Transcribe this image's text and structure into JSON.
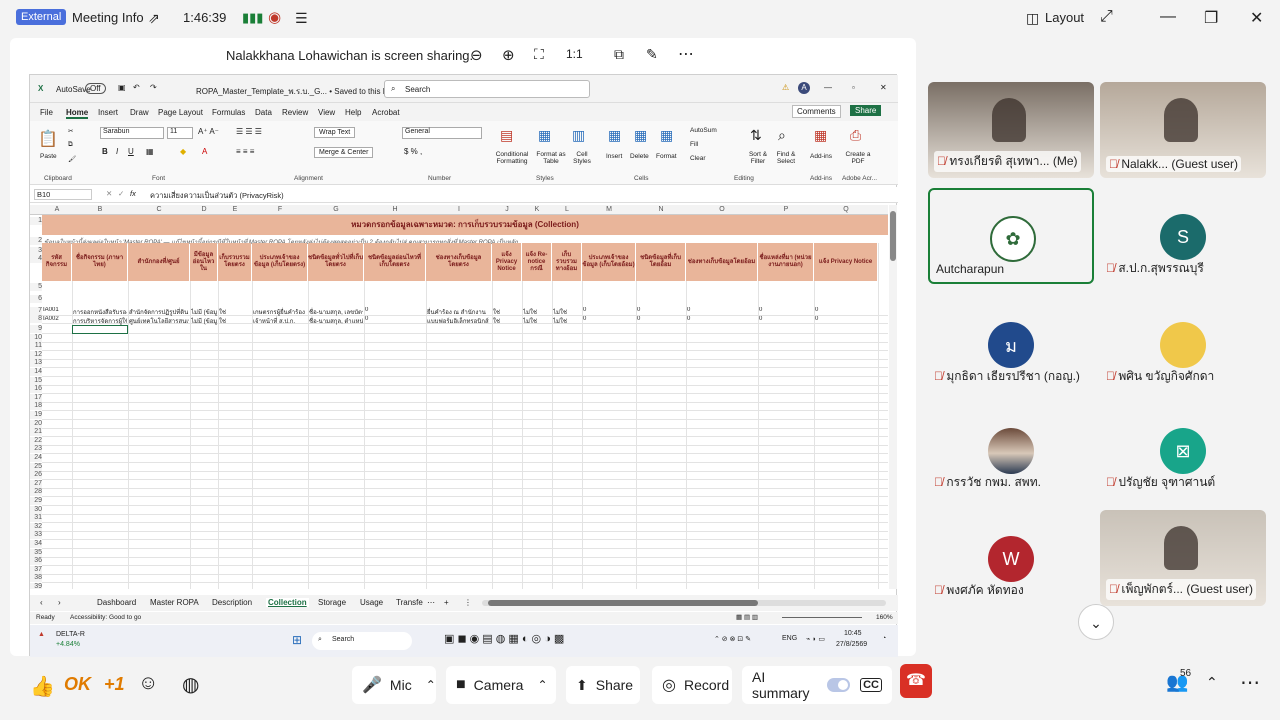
{
  "topbar": {
    "badge": "External",
    "meeting_info": "Meeting Info",
    "timer": "1:46:39",
    "layout": "Layout"
  },
  "share_banner": "Nalakkhana Lohawichan is screen sharing.",
  "excel": {
    "autosave": "AutoSave",
    "autosave_state": "Off",
    "filename": "ROPA_Master_Template_พ.ร.บ._G... • Saved to this PC",
    "search": "Search",
    "menu": [
      "File",
      "Home",
      "Insert",
      "Draw",
      "Page Layout",
      "Formulas",
      "Data",
      "Review",
      "View",
      "Help",
      "Acrobat"
    ],
    "comments": "Comments",
    "share": "Share",
    "font": "Sarabun",
    "font_size": "11",
    "number_format": "General",
    "wrap_text": "Wrap Text",
    "merge_center": "Merge & Center",
    "groups": [
      "Clipboard",
      "Font",
      "Alignment",
      "Number",
      "Styles",
      "Cells",
      "Editing",
      "Add-ins",
      "Adobe Acr..."
    ],
    "ribbon_buttons": [
      "Paste",
      "Conditional Formatting",
      "Format as Table",
      "Cell Styles",
      "Insert",
      "Delete",
      "Format",
      "AutoSum",
      "Fill",
      "Clear",
      "Sort & Filter",
      "Find & Select",
      "Add-ins",
      "Create a PDF"
    ],
    "name_box": "B10",
    "formula": "ความเสี่ยงความเป็นส่วนตัว (PrivacyRisk)",
    "columns": [
      "A",
      "B",
      "C",
      "D",
      "E",
      "F",
      "G",
      "H",
      "I",
      "J",
      "K",
      "L",
      "M",
      "N",
      "O",
      "P",
      "Q"
    ],
    "section_title": "หมวดกรอกข้อมูลเฉพาะหมวด: การเก็บรวบรวมข้อมูล (Collection)",
    "note": "ข้อมูลในหน้านี้ส่งผลต่อใบหน้า 'Master ROPA' — แก้ไขหน้านี้อยู่กรณีที่ในหน้าที่ Master ROPA โดยหลังส่งไม่ต้องสุดสุดอย่าเป็น 2 ต้องกลับไปสู่ คุณสามารถทุกสิ่งที่ Master ROPA เป็นหลัก ",
    "headers": [
      "รหัสกิจกรรม",
      "ชื่อกิจกรรม (ภาษาไทย)",
      "สำนักกองที่/ศูนย์",
      "มีข้อมูลอ่อนไหวใน",
      "เก็บรวบรวมโดยตรง",
      "ประเภทเจ้าของข้อมูล (เก็บโดยตรง)",
      "ชนิดข้อมูลทั่วไปที่เก็บโดยตรง",
      "ชนิดข้อมูลอ่อนไหวที่เก็บโดยตรง",
      "ช่องทางเก็บข้อมูลโดยตรง",
      "แจ้ง Privacy Notice",
      "แจ้ง Re-notice กรณี",
      "เก็บรวบรวมทางอ้อม",
      "ประเภทเจ้าของข้อมูล (เก็บโดยอ้อม)",
      "ชนิดข้อมูลที่เก็บโดยอ้อม",
      "ช่องทางเก็บข้อมูลโดยอ้อม",
      "ชื่อแหล่งที่มา (หน่วยงานภายนอก)",
      "แจ้ง Privacy Notice"
    ],
    "rows": [
      {
        "num": "8",
        "cells": [
          "IA001",
          "การออกหนังสือรับรองการทำปลา",
          "สำนักจัดการปฏิรูปที่ดิน",
          "ไม่มี (ข้อมูลทั่วไป)",
          "ใช่",
          "เกษตรกรผู้ยื่นคำร้อง",
          "ชื่อ-นามสกุล, เลขบัตรประชาชน",
          "0",
          "ยื่นคำร้อง ณ สำนักงาน",
          "ใช่",
          "ไม่ใช่",
          "ไม่ใช่",
          "0",
          "0",
          "0",
          "0",
          "0"
        ]
      },
      {
        "num": "9",
        "cells": [
          "IA002",
          "การบริหารจัดการผู้ใช้งานระบบ",
          "ศูนย์เทคโนโลยีสารสนเทศ",
          "ไม่มี (ข้อมูลทั่วไป)",
          "ใช่",
          "เจ้าหน้าที่ ส.ป.ก.",
          "ชื่อ-นามสกุล, ตำแหน่ง, สังกัด",
          "0",
          "แบบฟอร์มอิเล็กทรอนิกส์",
          "ใช่",
          "ไม่ใช่",
          "ไม่ใช่",
          "0",
          "0",
          "0",
          "0",
          "0"
        ]
      }
    ],
    "row_numbers": [
      "1",
      "2",
      "3",
      "4",
      "5",
      "6",
      "7",
      "8",
      "9",
      "10",
      "11",
      "12",
      "13",
      "14",
      "15",
      "16",
      "17",
      "18",
      "19",
      "20",
      "21",
      "22",
      "23",
      "24",
      "25",
      "26",
      "27",
      "28",
      "29",
      "30",
      "31",
      "32",
      "33",
      "34",
      "35",
      "36",
      "37",
      "38",
      "39"
    ],
    "sheet_tabs": [
      "Dashboard",
      "Master ROPA",
      "Description",
      "Collection",
      "Storage",
      "Usage",
      "Transfe"
    ],
    "active_tab": "Collection",
    "status_ready": "Ready",
    "accessibility": "Accessibility: Good to go",
    "zoom": "160%",
    "taskbar": {
      "stock_name": "DELTA-R",
      "stock_change": "+4.84%",
      "search": "Search",
      "lang": "ENG",
      "time": "10:45",
      "date": "27/8/2569"
    }
  },
  "participants": [
    {
      "name": "ทรงเกียรติ สุเทพา... (Me)",
      "type": "video",
      "bg": "#7a6f65"
    },
    {
      "name": "Nalakk... (Guest user)",
      "type": "video",
      "bg": "#b5a89a"
    },
    {
      "name": "Autcharapun",
      "type": "logo",
      "initial": ""
    },
    {
      "name": "ส.ป.ก.สุพรรณบุรี",
      "type": "avatar",
      "initial": "S",
      "color": "#1b6b6b"
    },
    {
      "name": "มุกธิดา เธียรปรีชา (กอญ.)",
      "type": "avatar",
      "initial": "ม",
      "color": "#214a8c"
    },
    {
      "name": "พศิน ขวัญกิจศักดา",
      "type": "avatar",
      "initial": "",
      "color": "#f0c84a"
    },
    {
      "name": "กรรวัช กพม. สพท.",
      "type": "photo",
      "initial": "",
      "color": "#3a5a7a"
    },
    {
      "name": "ปรัญชัย จุฑาศานต์",
      "type": "avatar",
      "initial": "⊠",
      "color": "#18a58a"
    },
    {
      "name": "พงศภัค หัดทอง",
      "type": "avatar",
      "initial": "W",
      "color": "#b3262e"
    },
    {
      "name": "เพ็ญพักตร์... (Guest user)",
      "type": "video",
      "bg": "#c9c2b8"
    }
  ],
  "bottombar": {
    "ok": "OK",
    "plus_one": "+1",
    "mic": "Mic",
    "camera": "Camera",
    "share": "Share",
    "record": "Record",
    "ai_summary": "AI summary",
    "participants_count": "56"
  }
}
